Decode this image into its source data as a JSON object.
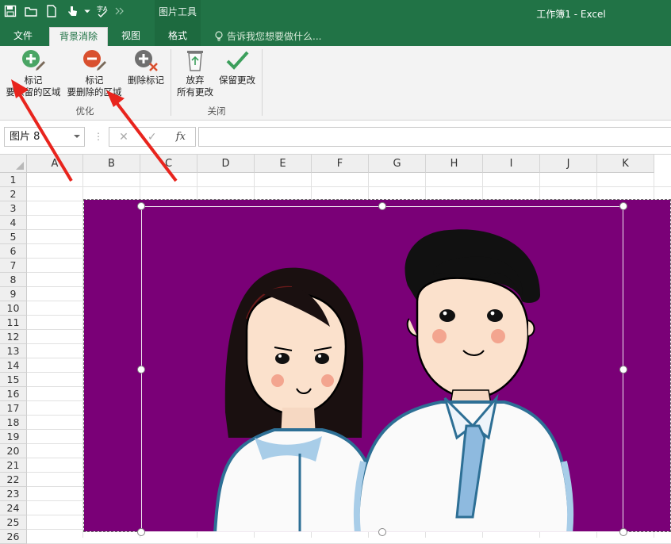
{
  "window": {
    "title": "工作簿1 - Excel",
    "context_group": "图片工具"
  },
  "tabs": [
    {
      "label": "文件"
    },
    {
      "label": "背景消除",
      "active": true
    },
    {
      "label": "视图"
    },
    {
      "label": "格式"
    }
  ],
  "tell_me": "告诉我您想要做什么...",
  "ribbon": {
    "mark_keep": {
      "line1": "标记",
      "line2": "要保留的区域"
    },
    "mark_remove": {
      "line1": "标记",
      "line2": "要删除的区域"
    },
    "delete_mark": {
      "line1": "删除标记"
    },
    "discard": {
      "line1": "放弃",
      "line2": "所有更改"
    },
    "keep": {
      "line1": "保留更改"
    },
    "group_refine": "优化",
    "group_close": "关闭"
  },
  "formula_bar": {
    "name_box": "图片 8",
    "dots": "⋮",
    "cancel": "✕",
    "enter": "✓",
    "fx": "fx",
    "value": ""
  },
  "columns": [
    "A",
    "B",
    "C",
    "D",
    "E",
    "F",
    "G",
    "H",
    "I",
    "J",
    "K"
  ],
  "rows": [
    "1",
    "2",
    "3",
    "4",
    "5",
    "6",
    "7",
    "8",
    "9",
    "10",
    "11",
    "12",
    "13",
    "14",
    "15",
    "16",
    "17",
    "18",
    "19",
    "20",
    "21",
    "22",
    "23",
    "24",
    "25",
    "26"
  ],
  "colors": {
    "excel_green": "#217346",
    "picture_bg": "#7a0077",
    "arrow": "#e8241d"
  }
}
